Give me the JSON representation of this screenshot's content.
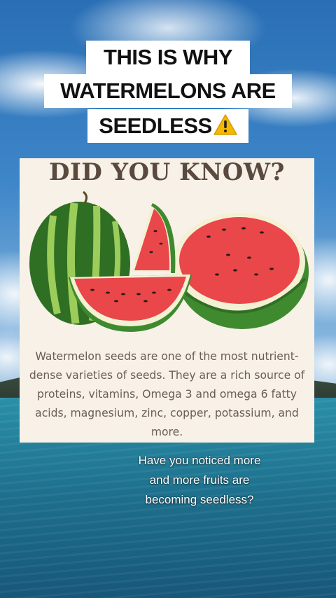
{
  "overlay_title": {
    "line1": "THIS IS WHY",
    "line2": "WATERMELONS ARE",
    "line3": "SEEDLESS"
  },
  "warning_emoji": "warning-sign-icon",
  "card": {
    "heading": "DID YOU KNOW?",
    "body": "Watermelon seeds are one of the most nutrient-dense varieties of seeds. They are a rich source of proteins, vitamins, Omega 3 and omega 6 fatty acids, magnesium, zinc, copper, potassium, and more."
  },
  "caption": {
    "line1": "Have you noticed more",
    "line2": "and more fruits are",
    "line3": "becoming seedless?"
  },
  "colors": {
    "title_bg": "#ffffff",
    "card_bg": "#f7f1e7",
    "card_heading": "#5a4a3e",
    "card_text": "#6a5e54",
    "melon_flesh": "#e9474a",
    "melon_rind": "#3f8a2e"
  }
}
